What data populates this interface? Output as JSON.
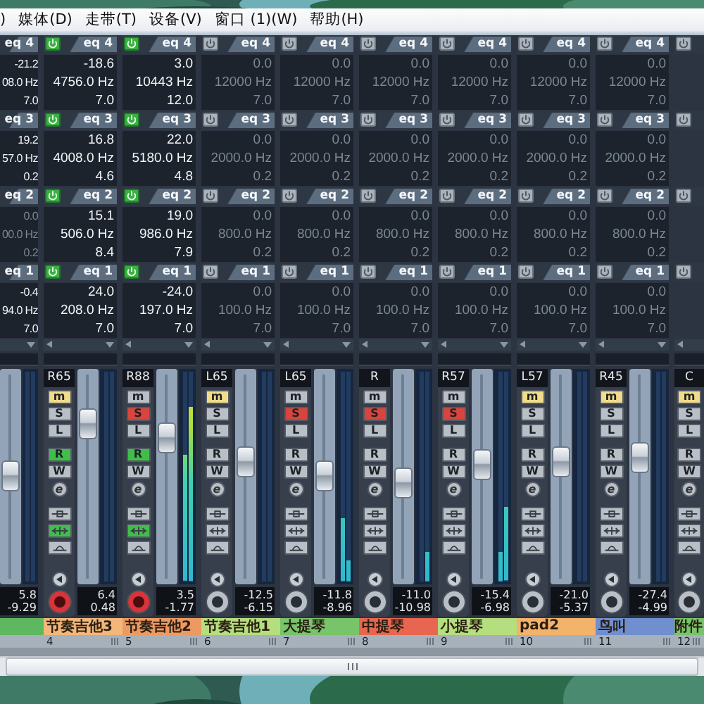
{
  "menu": [
    ")",
    "媒体(D)",
    "走带(T)",
    "设备(V)",
    "窗口 (1)(W)",
    "帮助(H)"
  ],
  "eq_columns": [
    {
      "kind": "left_cut",
      "bands": [
        {
          "label": "eq 4",
          "on": true,
          "values": [
            "-21.2",
            "08.0 Hz",
            "7.0"
          ]
        },
        {
          "label": "eq 3",
          "on": true,
          "values": [
            "19.2",
            "57.0 Hz",
            "0.2"
          ]
        },
        {
          "label": "eq 2",
          "on": false,
          "values": [
            "0.0",
            "00.0 Hz",
            "0.2"
          ]
        },
        {
          "label": "eq 1",
          "on": true,
          "values": [
            "-0.4",
            "94.0 Hz",
            "7.0"
          ]
        }
      ]
    },
    {
      "kind": "full",
      "bands": [
        {
          "label": "eq 4",
          "on": true,
          "values": [
            "-18.6",
            "4756.0 Hz",
            "7.0"
          ]
        },
        {
          "label": "eq 3",
          "on": true,
          "values": [
            "16.8",
            "4008.0 Hz",
            "4.6"
          ]
        },
        {
          "label": "eq 2",
          "on": true,
          "values": [
            "15.1",
            "506.0 Hz",
            "8.4"
          ]
        },
        {
          "label": "eq 1",
          "on": true,
          "values": [
            "24.0",
            "208.0 Hz",
            "7.0"
          ]
        }
      ]
    },
    {
      "kind": "full",
      "bands": [
        {
          "label": "eq 4",
          "on": true,
          "values": [
            "3.0",
            "10443 Hz",
            "12.0"
          ]
        },
        {
          "label": "eq 3",
          "on": true,
          "values": [
            "22.0",
            "5180.0 Hz",
            "4.8"
          ]
        },
        {
          "label": "eq 2",
          "on": true,
          "values": [
            "19.0",
            "986.0 Hz",
            "7.9"
          ]
        },
        {
          "label": "eq 1",
          "on": true,
          "values": [
            "-24.0",
            "197.0 Hz",
            "7.0"
          ]
        }
      ]
    },
    {
      "kind": "full",
      "bands": [
        {
          "label": "eq 4",
          "on": false,
          "values": [
            "0.0",
            "12000 Hz",
            "7.0"
          ]
        },
        {
          "label": "eq 3",
          "on": false,
          "values": [
            "0.0",
            "2000.0 Hz",
            "0.2"
          ]
        },
        {
          "label": "eq 2",
          "on": false,
          "values": [
            "0.0",
            "800.0 Hz",
            "0.2"
          ]
        },
        {
          "label": "eq 1",
          "on": false,
          "values": [
            "0.0",
            "100.0 Hz",
            "7.0"
          ]
        }
      ]
    },
    {
      "kind": "full",
      "bands": [
        {
          "label": "eq 4",
          "on": false,
          "values": [
            "0.0",
            "12000 Hz",
            "7.0"
          ]
        },
        {
          "label": "eq 3",
          "on": false,
          "values": [
            "0.0",
            "2000.0 Hz",
            "0.2"
          ]
        },
        {
          "label": "eq 2",
          "on": false,
          "values": [
            "0.0",
            "800.0 Hz",
            "0.2"
          ]
        },
        {
          "label": "eq 1",
          "on": false,
          "values": [
            "0.0",
            "100.0 Hz",
            "7.0"
          ]
        }
      ]
    },
    {
      "kind": "full",
      "bands": [
        {
          "label": "eq 4",
          "on": false,
          "values": [
            "0.0",
            "12000 Hz",
            "7.0"
          ]
        },
        {
          "label": "eq 3",
          "on": false,
          "values": [
            "0.0",
            "2000.0 Hz",
            "0.2"
          ]
        },
        {
          "label": "eq 2",
          "on": false,
          "values": [
            "0.0",
            "800.0 Hz",
            "0.2"
          ]
        },
        {
          "label": "eq 1",
          "on": false,
          "values": [
            "0.0",
            "100.0 Hz",
            "7.0"
          ]
        }
      ]
    },
    {
      "kind": "full",
      "bands": [
        {
          "label": "eq 4",
          "on": false,
          "values": [
            "0.0",
            "12000 Hz",
            "7.0"
          ]
        },
        {
          "label": "eq 3",
          "on": false,
          "values": [
            "0.0",
            "2000.0 Hz",
            "0.2"
          ]
        },
        {
          "label": "eq 2",
          "on": false,
          "values": [
            "0.0",
            "800.0 Hz",
            "0.2"
          ]
        },
        {
          "label": "eq 1",
          "on": false,
          "values": [
            "0.0",
            "100.0 Hz",
            "7.0"
          ]
        }
      ]
    },
    {
      "kind": "full",
      "bands": [
        {
          "label": "eq 4",
          "on": false,
          "values": [
            "0.0",
            "12000 Hz",
            "7.0"
          ]
        },
        {
          "label": "eq 3",
          "on": false,
          "values": [
            "0.0",
            "2000.0 Hz",
            "0.2"
          ]
        },
        {
          "label": "eq 2",
          "on": false,
          "values": [
            "0.0",
            "800.0 Hz",
            "0.2"
          ]
        },
        {
          "label": "eq 1",
          "on": false,
          "values": [
            "0.0",
            "100.0 Hz",
            "7.0"
          ]
        }
      ]
    },
    {
      "kind": "full",
      "bands": [
        {
          "label": "eq 4",
          "on": false,
          "values": [
            "0.0",
            "12000 Hz",
            "7.0"
          ]
        },
        {
          "label": "eq 3",
          "on": false,
          "values": [
            "0.0",
            "2000.0 Hz",
            "0.2"
          ]
        },
        {
          "label": "eq 2",
          "on": false,
          "values": [
            "0.0",
            "800.0 Hz",
            "0.2"
          ]
        },
        {
          "label": "eq 1",
          "on": false,
          "values": [
            "0.0",
            "100.0 Hz",
            "7.0"
          ]
        }
      ]
    },
    {
      "kind": "right_cut",
      "bands": [
        {
          "on": false
        },
        {
          "on": false
        },
        {
          "on": false
        },
        {
          "on": false
        }
      ]
    }
  ],
  "strips": [
    {
      "kind": "right_cut",
      "fader": {
        "level": 0.5
      },
      "meter": [
        {
          "level": 0
        },
        {
          "level": 0
        }
      ],
      "readouts": [
        "5.8",
        "-9.29"
      ],
      "color": "#5fb85f"
    },
    {
      "kind": "full",
      "pan": "R65",
      "buttons": [
        {
          "kind": "mute",
          "label": "m",
          "on": true
        },
        {
          "kind": "solo",
          "label": "S",
          "on": false
        },
        {
          "kind": "listen",
          "label": "L",
          "on": false
        },
        {
          "kind": "read",
          "label": "R",
          "on": true
        },
        {
          "kind": "write",
          "label": "W",
          "on": false
        },
        {
          "kind": "edit",
          "label": "e"
        },
        {
          "kind": "insert_bypass",
          "on": false
        },
        {
          "kind": "eq_bypass",
          "on": true
        },
        {
          "kind": "send_bypass",
          "on": false
        }
      ],
      "record": true,
      "fader": {
        "level": 0.78
      },
      "meter": [
        {
          "level": 0
        },
        {
          "level": 0
        }
      ],
      "readouts": [
        "6.4",
        "0.48"
      ],
      "name": "节奏吉他3",
      "color": "#f3b77a",
      "number": "4"
    },
    {
      "kind": "full",
      "pan": "R88",
      "buttons": [
        {
          "kind": "mute",
          "label": "m",
          "on": false
        },
        {
          "kind": "solo",
          "label": "S",
          "on": true
        },
        {
          "kind": "listen",
          "label": "L",
          "on": false
        },
        {
          "kind": "read",
          "label": "R",
          "on": true
        },
        {
          "kind": "write",
          "label": "W",
          "on": false
        },
        {
          "kind": "edit",
          "label": "e"
        },
        {
          "kind": "insert_bypass",
          "on": false
        },
        {
          "kind": "eq_bypass",
          "on": true
        },
        {
          "kind": "send_bypass",
          "on": false
        }
      ],
      "record": true,
      "fader": {
        "level": 0.71
      },
      "meter": [
        {
          "level": 0.6
        },
        {
          "level": 0.83
        }
      ],
      "readouts": [
        "3.5",
        "-1.77"
      ],
      "name": "节奏吉他2",
      "color": "#ec9a62",
      "number": "5"
    },
    {
      "kind": "full",
      "pan": "L65",
      "buttons": [
        {
          "kind": "mute",
          "label": "m",
          "on": true
        },
        {
          "kind": "solo",
          "label": "S",
          "on": false
        },
        {
          "kind": "listen",
          "label": "L",
          "on": false
        },
        {
          "kind": "read",
          "label": "R",
          "on": false
        },
        {
          "kind": "write",
          "label": "W",
          "on": false
        },
        {
          "kind": "edit",
          "label": "e"
        },
        {
          "kind": "insert_bypass",
          "on": false
        },
        {
          "kind": "eq_bypass",
          "on": false
        },
        {
          "kind": "send_bypass",
          "on": false
        }
      ],
      "record": false,
      "fader": {
        "level": 0.58
      },
      "meter": [
        {
          "level": 0
        },
        {
          "level": 0
        }
      ],
      "readouts": [
        "-12.5",
        "-6.15"
      ],
      "name": "节奏吉他1",
      "color": "#b5de7e",
      "number": "6"
    },
    {
      "kind": "full",
      "pan": "L65",
      "buttons": [
        {
          "kind": "mute",
          "label": "m",
          "on": false
        },
        {
          "kind": "solo",
          "label": "S",
          "on": true
        },
        {
          "kind": "listen",
          "label": "L",
          "on": false
        },
        {
          "kind": "read",
          "label": "R",
          "on": false
        },
        {
          "kind": "write",
          "label": "W",
          "on": false
        },
        {
          "kind": "edit",
          "label": "e"
        },
        {
          "kind": "insert_bypass",
          "on": false
        },
        {
          "kind": "eq_bypass",
          "on": false
        },
        {
          "kind": "send_bypass",
          "on": false
        }
      ],
      "record": false,
      "fader": {
        "level": 0.5
      },
      "meter": [
        {
          "level": 0.3
        },
        {
          "level": 0.1
        }
      ],
      "readouts": [
        "-11.8",
        "-8.96"
      ],
      "name": "大提琴",
      "color": "#78c46a",
      "number": "7"
    },
    {
      "kind": "full",
      "pan": "R",
      "buttons": [
        {
          "kind": "mute",
          "label": "m",
          "on": false
        },
        {
          "kind": "solo",
          "label": "S",
          "on": true
        },
        {
          "kind": "listen",
          "label": "L",
          "on": false
        },
        {
          "kind": "read",
          "label": "R",
          "on": false
        },
        {
          "kind": "write",
          "label": "W",
          "on": false
        },
        {
          "kind": "edit",
          "label": "e"
        },
        {
          "kind": "insert_bypass",
          "on": false
        },
        {
          "kind": "eq_bypass",
          "on": false
        },
        {
          "kind": "send_bypass",
          "on": false
        }
      ],
      "record": false,
      "fader": {
        "level": 0.46
      },
      "meter": [
        {
          "level": 0
        },
        {
          "level": 0.14
        }
      ],
      "readouts": [
        "-11.0",
        "-10.98"
      ],
      "name": "中提琴",
      "color": "#e8664f",
      "number": "8"
    },
    {
      "kind": "full",
      "pan": "R57",
      "buttons": [
        {
          "kind": "mute",
          "label": "m",
          "on": false
        },
        {
          "kind": "solo",
          "label": "S",
          "on": true
        },
        {
          "kind": "listen",
          "label": "L",
          "on": false
        },
        {
          "kind": "read",
          "label": "R",
          "on": false
        },
        {
          "kind": "write",
          "label": "W",
          "on": false
        },
        {
          "kind": "edit",
          "label": "e"
        },
        {
          "kind": "insert_bypass",
          "on": false
        },
        {
          "kind": "eq_bypass",
          "on": false
        },
        {
          "kind": "send_bypass",
          "on": false
        }
      ],
      "record": false,
      "fader": {
        "level": 0.56
      },
      "meter": [
        {
          "level": 0.14
        },
        {
          "level": 0.35
        }
      ],
      "readouts": [
        "-15.4",
        "-6.98"
      ],
      "name": "小提琴",
      "color": "#b5de7e",
      "number": "9"
    },
    {
      "kind": "full",
      "pan": "L57",
      "buttons": [
        {
          "kind": "mute",
          "label": "m",
          "on": true
        },
        {
          "kind": "solo",
          "label": "S",
          "on": false
        },
        {
          "kind": "listen",
          "label": "L",
          "on": false
        },
        {
          "kind": "read",
          "label": "R",
          "on": false
        },
        {
          "kind": "write",
          "label": "W",
          "on": false
        },
        {
          "kind": "edit",
          "label": "e"
        },
        {
          "kind": "insert_bypass",
          "on": false
        },
        {
          "kind": "eq_bypass",
          "on": false
        },
        {
          "kind": "send_bypass",
          "on": false
        }
      ],
      "record": false,
      "fader": {
        "level": 0.58
      },
      "meter": [
        {
          "level": 0
        },
        {
          "level": 0
        }
      ],
      "readouts": [
        "-21.0",
        "-5.37"
      ],
      "name": "pad2",
      "color": "#f3b36a",
      "number": "10"
    },
    {
      "kind": "full",
      "pan": "R45",
      "buttons": [
        {
          "kind": "mute",
          "label": "m",
          "on": true
        },
        {
          "kind": "solo",
          "label": "S",
          "on": false
        },
        {
          "kind": "listen",
          "label": "L",
          "on": false
        },
        {
          "kind": "read",
          "label": "R",
          "on": false
        },
        {
          "kind": "write",
          "label": "W",
          "on": false
        },
        {
          "kind": "edit",
          "label": "e"
        },
        {
          "kind": "insert_bypass",
          "on": false
        },
        {
          "kind": "eq_bypass",
          "on": false
        },
        {
          "kind": "send_bypass",
          "on": false
        }
      ],
      "record": false,
      "fader": {
        "level": 0.6
      },
      "meter": [
        {
          "level": 0
        },
        {
          "level": 0
        }
      ],
      "readouts": [
        "-27.4",
        "-4.99"
      ],
      "name": "鸟叫",
      "color": "#6f8fcf",
      "number": "11"
    },
    {
      "kind": "left_cut",
      "pan": "C",
      "buttons": [
        {
          "kind": "mute",
          "label": "m",
          "on": true
        },
        {
          "kind": "solo",
          "label": "S",
          "on": false
        },
        {
          "kind": "listen",
          "label": "L",
          "on": false
        },
        {
          "kind": "read",
          "label": "R",
          "on": false
        },
        {
          "kind": "write",
          "label": "W",
          "on": false
        },
        {
          "kind": "edit",
          "label": "e"
        },
        {
          "kind": "insert_bypass",
          "on": false
        },
        {
          "kind": "eq_bypass",
          "on": false
        },
        {
          "kind": "send_bypass",
          "on": false
        }
      ],
      "record": false,
      "name": "附件",
      "color": "#78c46a",
      "number": "12"
    }
  ]
}
